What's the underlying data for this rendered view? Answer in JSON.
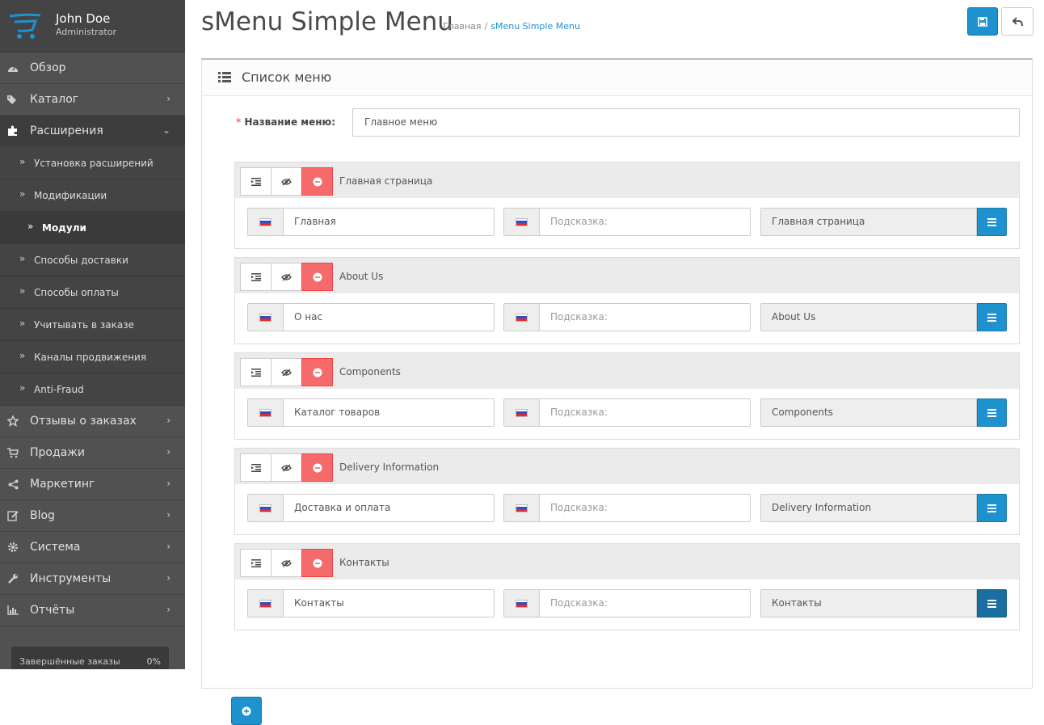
{
  "user": {
    "name": "John Doe",
    "role": "Administrator"
  },
  "nav": {
    "items_top": [
      {
        "label": "Обзор",
        "icon": "dashboard-icon"
      },
      {
        "label": "Каталог",
        "icon": "tags-icon"
      },
      {
        "label": "Расширения",
        "icon": "puzzle-icon"
      }
    ],
    "sub_items": [
      {
        "label": "Установка расширений"
      },
      {
        "label": "Модификации"
      },
      {
        "label": "Модули"
      },
      {
        "label": "Способы доставки"
      },
      {
        "label": "Способы оплаты"
      },
      {
        "label": "Учитывать в заказе"
      },
      {
        "label": "Каналы продвижения"
      },
      {
        "label": "Anti-Fraud"
      }
    ],
    "items_bottom": [
      {
        "label": "Отзывы о заказах",
        "icon": "star-icon"
      },
      {
        "label": "Продажи",
        "icon": "cart-icon"
      },
      {
        "label": "Маркетинг",
        "icon": "share-icon"
      },
      {
        "label": "Blog",
        "icon": "edit-icon"
      },
      {
        "label": "Система",
        "icon": "cog-icon"
      },
      {
        "label": "Инструменты",
        "icon": "wrench-icon"
      },
      {
        "label": "Отчёты",
        "icon": "bar-chart-icon"
      }
    ],
    "active_sub": "Модули"
  },
  "progress": {
    "label": "Завершённые заказы",
    "value": "0%"
  },
  "header": {
    "title": "sMenu Simple Menu",
    "breadcrumb": [
      "Главная",
      "sMenu Simple Menu"
    ],
    "breadcrumb_sep": "/"
  },
  "panel": {
    "title": "Список меню",
    "name_required_mark": "*",
    "name_label": "Название меню:",
    "name_value": "Главное меню"
  },
  "menu_items": [
    {
      "title": "Главная страница",
      "name": "Главная",
      "hint_placeholder": "Подсказка:",
      "link": "Главная страница"
    },
    {
      "title": "About Us",
      "name": "О нас",
      "hint_placeholder": "Подсказка:",
      "link": "About Us"
    },
    {
      "title": "Components",
      "name": "Каталог товаров",
      "hint_placeholder": "Подсказка:",
      "link": "Components"
    },
    {
      "title": "Delivery Information",
      "name": "Доставка и оплата",
      "hint_placeholder": "Подсказка:",
      "link": "Delivery Information"
    },
    {
      "title": "Контакты",
      "name": "Контакты",
      "hint_placeholder": "Подсказка:",
      "link": "Контакты"
    }
  ],
  "colors": {
    "sidebar": "#515151",
    "primary": "#1e91cf",
    "danger": "#f56b6b"
  }
}
